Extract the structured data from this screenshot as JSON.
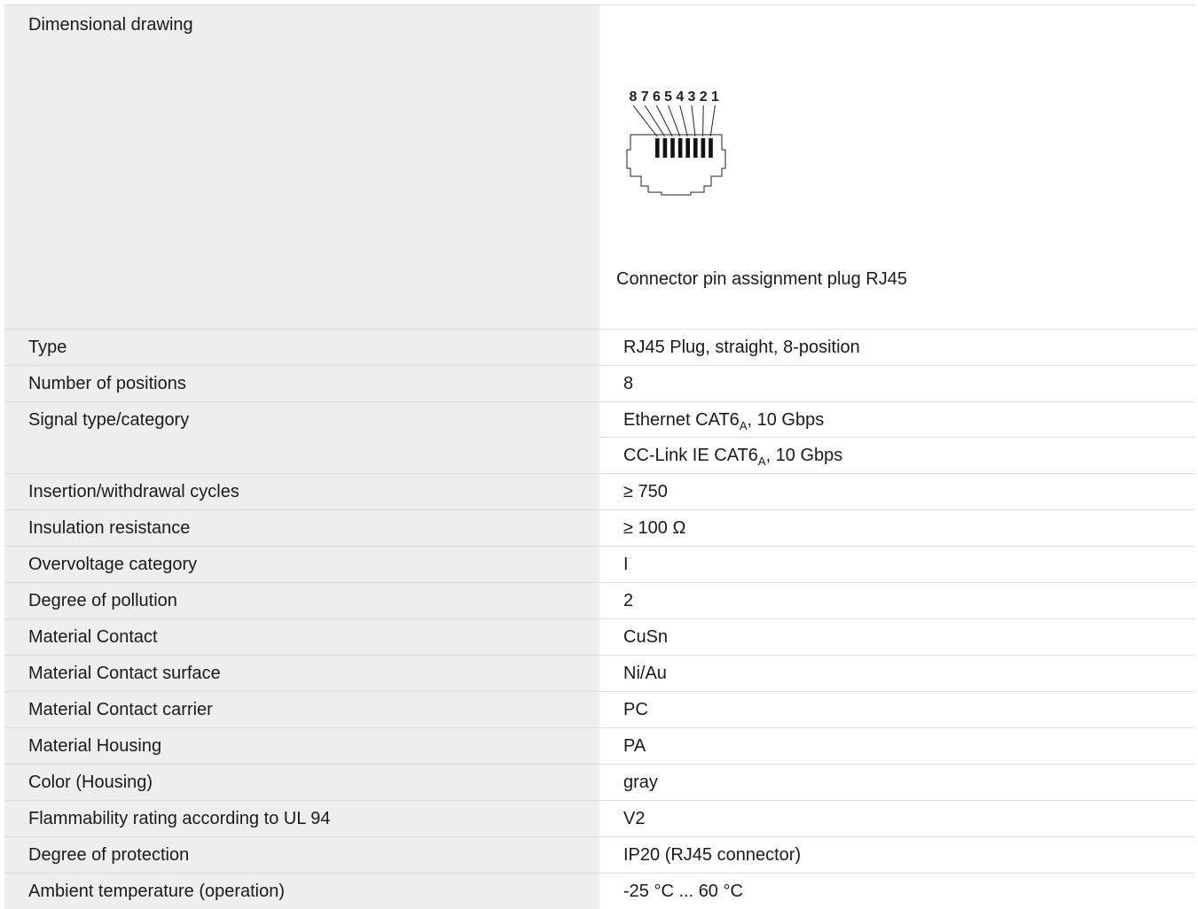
{
  "drawing": {
    "label": "Dimensional drawing",
    "pin_numbers": [
      "8",
      "7",
      "6",
      "5",
      "4",
      "3",
      "2",
      "1"
    ],
    "caption": "Connector pin assignment plug RJ45"
  },
  "specs": [
    {
      "label": "Type",
      "values": [
        {
          "text": "RJ45 Plug, straight, 8-position"
        }
      ]
    },
    {
      "label": "Number of positions",
      "values": [
        {
          "text": "8"
        }
      ]
    },
    {
      "label": "Signal type/category",
      "values": [
        {
          "text": "Ethernet CAT6",
          "sub": "A",
          "after": ", 10 Gbps"
        },
        {
          "text": "CC-Link IE CAT6",
          "sub": "A",
          "after": ", 10 Gbps"
        }
      ]
    },
    {
      "label": "Insertion/withdrawal cycles",
      "values": [
        {
          "text": "≥ 750"
        }
      ]
    },
    {
      "label": "Insulation resistance",
      "values": [
        {
          "text": "≥ 100 Ω"
        }
      ]
    },
    {
      "label": "Overvoltage category",
      "values": [
        {
          "text": "I"
        }
      ]
    },
    {
      "label": "Degree of pollution",
      "values": [
        {
          "text": "2"
        }
      ]
    },
    {
      "label": "Material Contact",
      "values": [
        {
          "text": "CuSn"
        }
      ]
    },
    {
      "label": "Material Contact surface",
      "values": [
        {
          "text": "Ni/Au"
        }
      ]
    },
    {
      "label": "Material Contact carrier",
      "values": [
        {
          "text": "PC"
        }
      ]
    },
    {
      "label": "Material Housing",
      "values": [
        {
          "text": "PA"
        }
      ]
    },
    {
      "label": "Color (Housing)",
      "values": [
        {
          "text": "gray"
        }
      ]
    },
    {
      "label": "Flammability rating according to UL 94",
      "values": [
        {
          "text": "V2"
        }
      ]
    },
    {
      "label": "Degree of protection",
      "values": [
        {
          "text": "IP20 (RJ45 connector)"
        }
      ]
    },
    {
      "label": "Ambient temperature (operation)",
      "values": [
        {
          "text": "-25 °C ... 60 °C"
        }
      ]
    }
  ]
}
